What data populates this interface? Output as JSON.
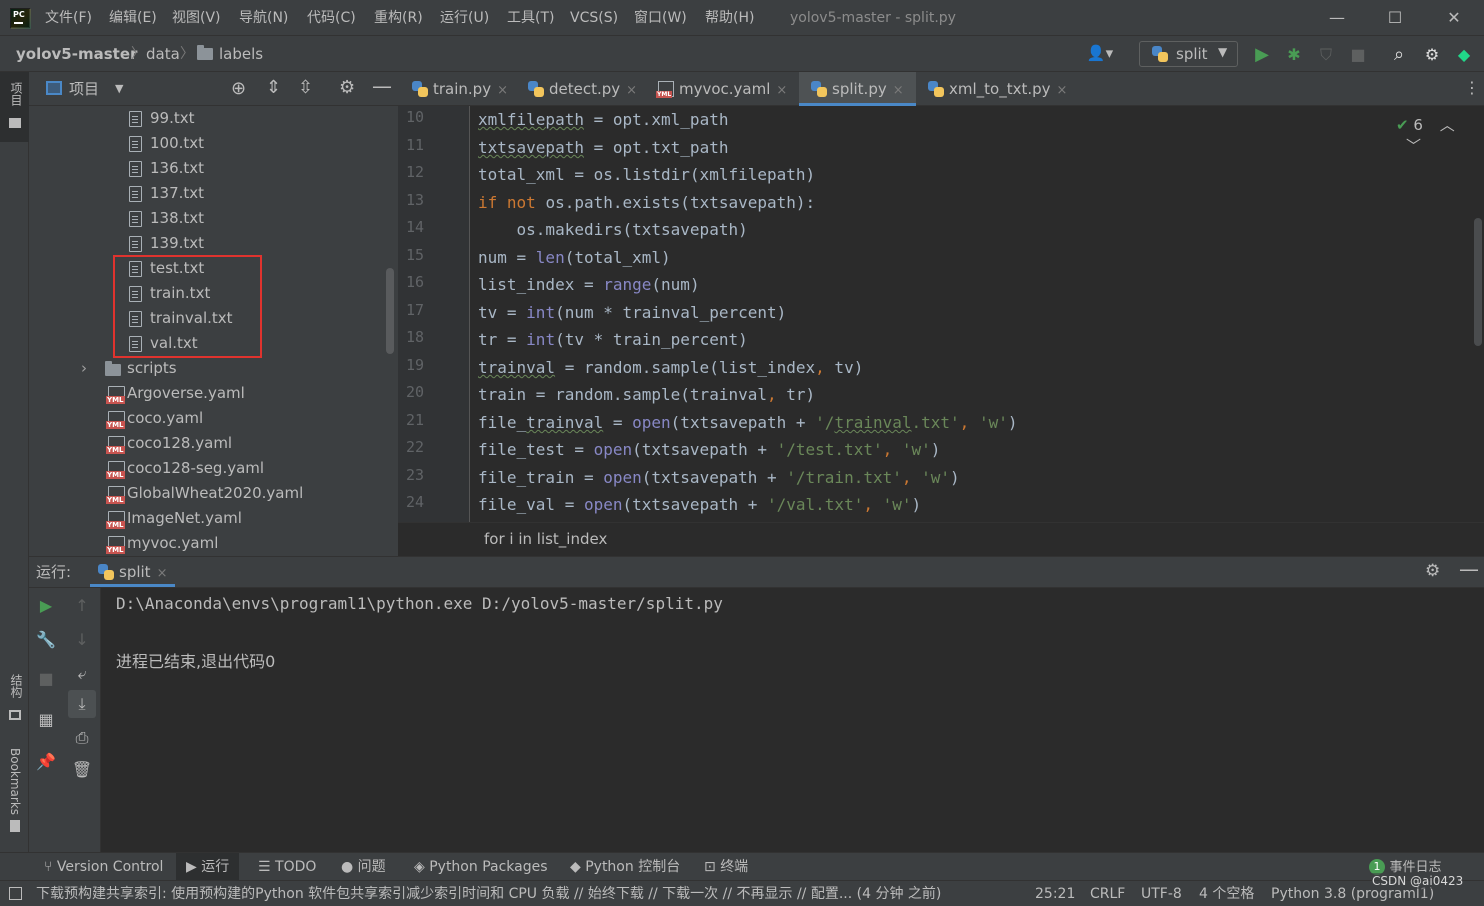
{
  "title_bar": {
    "logo": "PC",
    "menu": [
      "文件(F)",
      "编辑(E)",
      "视图(V)",
      "导航(N)",
      "代码(C)",
      "重构(R)",
      "运行(U)",
      "工具(T)",
      "VCS(S)",
      "窗口(W)",
      "帮助(H)"
    ],
    "window_title": "yolov5-master - split.py",
    "minimize": "—",
    "maximize": "☐",
    "close": "✕"
  },
  "nav_bar": {
    "crumbs": [
      "yolov5-master",
      "data",
      "labels"
    ],
    "separator": "〉",
    "run_config": "split"
  },
  "left_strip": {
    "project": "项目",
    "structure": "结构",
    "bookmarks": "Bookmarks"
  },
  "project_panel": {
    "title": "项目",
    "files": [
      "99.txt",
      "100.txt",
      "136.txt",
      "137.txt",
      "138.txt",
      "139.txt",
      "test.txt",
      "train.txt",
      "trainval.txt",
      "val.txt"
    ],
    "folder": "scripts",
    "yamls": [
      "Argoverse.yaml",
      "coco.yaml",
      "coco128.yaml",
      "coco128-seg.yaml",
      "GlobalWheat2020.yaml",
      "ImageNet.yaml",
      "myvoc.yaml"
    ]
  },
  "tabs": [
    {
      "label": "train.py",
      "kind": "py"
    },
    {
      "label": "detect.py",
      "kind": "py"
    },
    {
      "label": "myvoc.yaml",
      "kind": "yaml"
    },
    {
      "label": "split.py",
      "kind": "py"
    },
    {
      "label": "xml_to_txt.py",
      "kind": "py"
    }
  ],
  "tab_close": "×",
  "active_tab": 3,
  "editor": {
    "line_numbers": [
      "10",
      "11",
      "12",
      "13",
      "14",
      "15",
      "16",
      "17",
      "18",
      "19",
      "20",
      "21",
      "22",
      "23",
      "24"
    ],
    "inspection_count": "6",
    "breadcrumb": "for i in list_index"
  },
  "run_panel": {
    "label": "运行:",
    "tab": "split",
    "command": "D:\\Anaconda\\envs\\programl1\\python.exe D:/yolov5-master/split.py",
    "result": "进程已结束,退出代码0"
  },
  "bottom_tools": [
    "Version Control",
    "运行",
    "TODO",
    "问题",
    "Python Packages",
    "Python 控制台",
    "终端"
  ],
  "event_log": {
    "count": "1",
    "label": "事件日志"
  },
  "status_bar": {
    "message": "下载预构建共享索引: 使用预构建的Python 软件包共享索引减少索引时间和 CPU 负载 // 始终下载 // 下载一次 // 不再显示 // 配置... (4 分钟 之前)",
    "position": "25:21",
    "line_sep": "CRLF",
    "encoding": "UTF-8",
    "indent": "4 个空格",
    "interpreter": "Python 3.8 (programl1)",
    "watermark": "CSDN @ai0423"
  },
  "colors": {
    "keyword": "#cc7832",
    "builtin": "#8888c6",
    "string": "#6a8759",
    "highlight_box": "#e0332e",
    "accent": "#4a88c7"
  }
}
